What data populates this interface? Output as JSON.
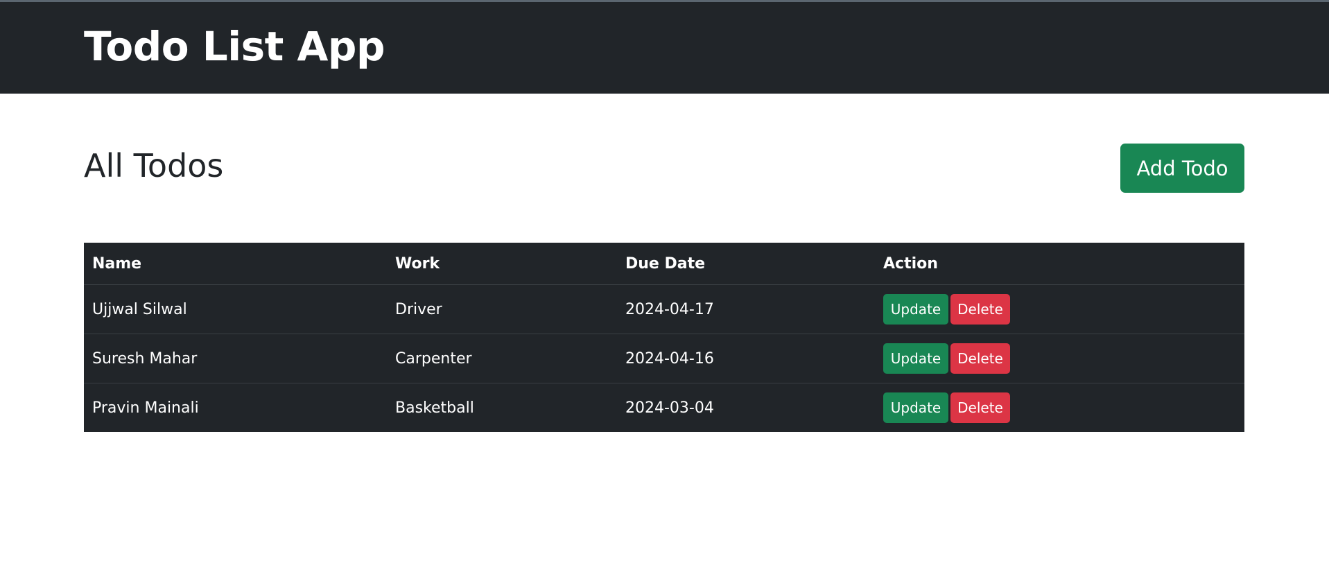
{
  "header": {
    "title": "Todo List App"
  },
  "main": {
    "heading": "All Todos",
    "add_button_label": "Add Todo"
  },
  "table": {
    "columns": {
      "name": "Name",
      "work": "Work",
      "due_date": "Due Date",
      "action": "Action"
    },
    "rows": [
      {
        "name": "Ujjwal Silwal",
        "work": "Driver",
        "due_date": "2024-04-17"
      },
      {
        "name": "Suresh Mahar",
        "work": "Carpenter",
        "due_date": "2024-04-16"
      },
      {
        "name": "Pravin Mainali",
        "work": "Basketball",
        "due_date": "2024-03-04"
      }
    ],
    "update_label": "Update",
    "delete_label": "Delete"
  },
  "colors": {
    "navbar": "#212529",
    "success": "#198754",
    "danger": "#dc3545"
  }
}
